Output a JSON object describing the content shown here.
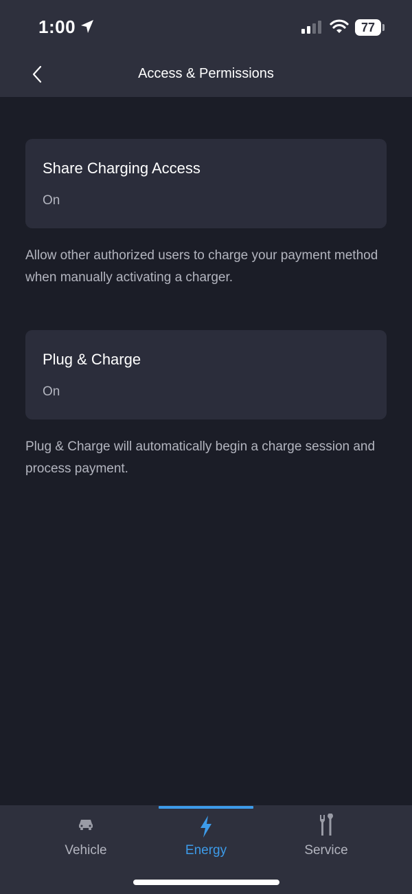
{
  "status_bar": {
    "time": "1:00",
    "battery": "77"
  },
  "header": {
    "title": "Access & Permissions"
  },
  "settings": [
    {
      "title": "Share Charging Access",
      "value": "On",
      "description": "Allow other authorized users to charge your payment method when manually activating a charger."
    },
    {
      "title": "Plug & Charge",
      "value": "On",
      "description": "Plug & Charge will automatically begin a charge session and process payment."
    }
  ],
  "tab_bar": {
    "tabs": [
      {
        "label": "Vehicle",
        "icon": "car-icon"
      },
      {
        "label": "Energy",
        "icon": "lightning-bolt-icon"
      },
      {
        "label": "Service",
        "icon": "tools-icon"
      }
    ],
    "active_tab": "Energy"
  },
  "colors": {
    "background": "#1b1d27",
    "header": "#2e303d",
    "card": "#2b2d3b",
    "accent": "#3d9be9",
    "text_secondary": "#b3b5bf"
  }
}
